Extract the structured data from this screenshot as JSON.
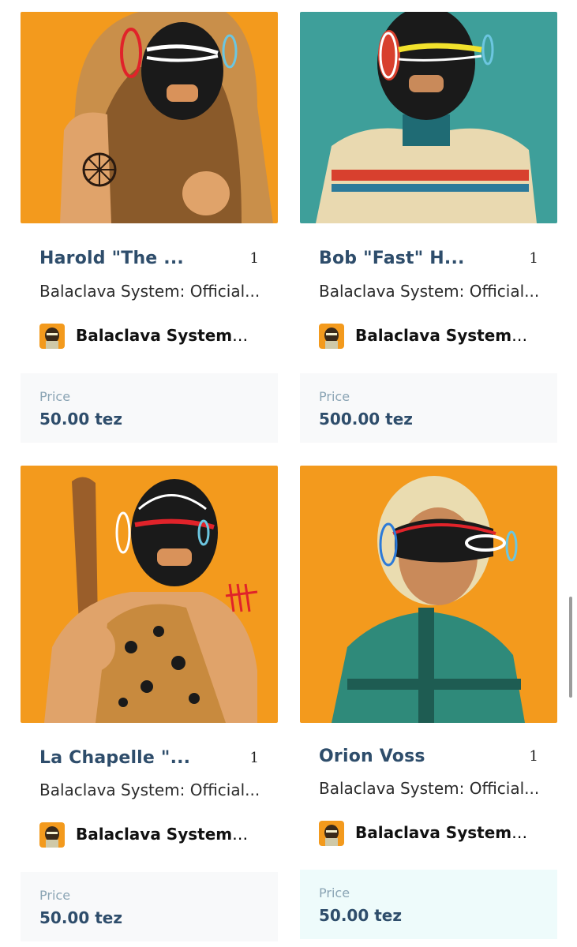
{
  "cards": [
    {
      "title": "Harold \"The ...",
      "edition": "1",
      "collection": "Balaclava System: Official...",
      "creator_name": "Balaclava System",
      "creator_handle": "@...",
      "price_label": "Price",
      "price_value": "50.00 tez"
    },
    {
      "title": "Bob \"Fast\" H...",
      "edition": "1",
      "collection": "Balaclava System: Official...",
      "creator_name": "Balaclava System",
      "creator_handle": "@...",
      "price_label": "Price",
      "price_value": "500.00 tez"
    },
    {
      "title": "La Chapelle \"...",
      "edition": "1",
      "collection": "Balaclava System: Official...",
      "creator_name": "Balaclava System",
      "creator_handle": "@...",
      "price_label": "Price",
      "price_value": "50.00 tez"
    },
    {
      "title": "Orion Voss",
      "edition": "1",
      "collection": "Balaclava System: Official...",
      "creator_name": "Balaclava System",
      "creator_handle": "@...",
      "price_label": "Price",
      "price_value": "50.00 tez"
    }
  ],
  "colors": {
    "title": "#2e4d6b",
    "price_value": "#2e4d6b",
    "price_label": "#8aa4b4",
    "orange_bg": "#f39a1d",
    "teal_bg": "#3e9f9a"
  }
}
